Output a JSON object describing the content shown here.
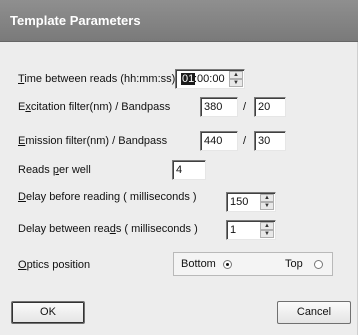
{
  "window": {
    "title": "Template Parameters"
  },
  "time_between_reads": {
    "label_key": "T",
    "label_rest": "ime between reads (hh:mm:ss)",
    "hours": "01",
    "rest": ":00:00"
  },
  "excitation": {
    "label_pre": "E",
    "label_key": "x",
    "label_rest": "citation filter(nm) / Bandpass",
    "filter": "380",
    "bandpass": "20"
  },
  "emission": {
    "label_key": "E",
    "label_rest": "mission filter(nm) / Bandpass",
    "filter": "440",
    "bandpass": "30"
  },
  "separator": "/",
  "reads_per_well": {
    "label_pre": "Reads ",
    "label_key": "p",
    "label_rest": "er well",
    "value": "4"
  },
  "delay_before": {
    "label_key": "D",
    "label_rest": "elay before reading ( milliseconds )",
    "value": "150"
  },
  "delay_between": {
    "label_pre": "Delay between rea",
    "label_key": "d",
    "label_rest": "s ( milliseconds )",
    "value": "1"
  },
  "optics": {
    "label_key": "O",
    "label_rest": "ptics position",
    "options": [
      "Bottom",
      "Top"
    ],
    "selected": "Bottom"
  },
  "buttons": {
    "ok": "OK",
    "cancel": "Cancel"
  },
  "icons": {
    "spin_up": "spin-up-arrow-icon",
    "spin_down": "spin-down-arrow-icon",
    "radio": "radio-button-icon"
  }
}
